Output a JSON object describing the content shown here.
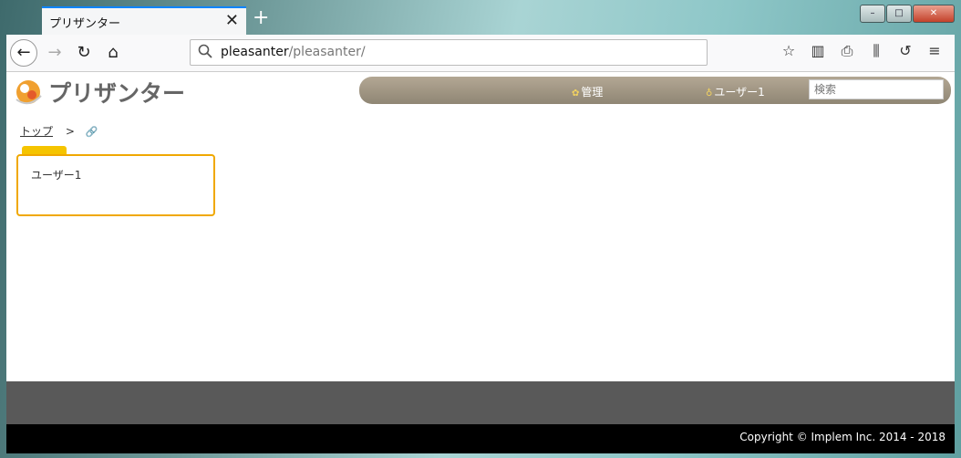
{
  "browser": {
    "tab_title": "プリザンター",
    "tab_close": "✕",
    "new_tab": "+",
    "url_host": "pleasanter",
    "url_path": "/pleasanter/",
    "window_controls": {
      "minimize": "–",
      "maximize": "□",
      "close": "✕"
    }
  },
  "app": {
    "logo_text": "プリザンター",
    "nav": {
      "admin_label": "管理",
      "user_label": "ユーザー1"
    },
    "search": {
      "placeholder": "検索"
    }
  },
  "breadcrumb": {
    "top_label": "トップ",
    "separator": ">"
  },
  "site_card": {
    "title": "ユーザー1"
  },
  "footer": {
    "copyright": "Copyright © Implem Inc. 2014 - 2018"
  },
  "colors": {
    "accent": "#f0a800",
    "navbar": "#a09682",
    "footer_dark": "#595959"
  }
}
